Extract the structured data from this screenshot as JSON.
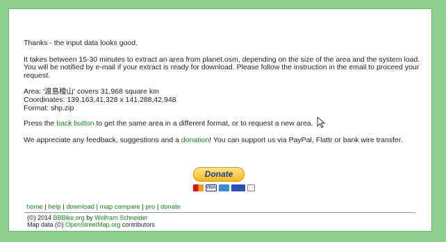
{
  "message": {
    "thanks": "Thanks - the input data looks good.",
    "info": "It takes between 15-30 minutes to extract an area from planet.osm, depending on the size of the area and the system load. You will be notified by e-mail if your extract is ready for download. Please follow the instruction in the email to proceed your request.",
    "area_prefix": "Area: '",
    "area_name": "渡島檜山",
    "area_suffix": "' covers 31,968 square km",
    "coordinates": "Coordinates: 139.163,41.328 x 141.288,42.948",
    "format": "Format: shp.zip",
    "press_prefix": "Press the ",
    "back_button": "back button",
    "press_suffix": " to get the same area in a different format, or to request a new area.",
    "appreciate_prefix": "We appreciate any feedback, suggestions and a ",
    "donation_link": "donation",
    "appreciate_suffix": "! You can support us via PayPal, Flattr or bank wire transfer."
  },
  "donate": {
    "label": "Donate",
    "cards": [
      "mastercard",
      "VISA",
      "amex",
      "giropay",
      "bank"
    ]
  },
  "footer": {
    "nav": [
      "home",
      "help",
      "download",
      "map compare",
      "pro",
      "donate"
    ],
    "separator": " | ",
    "copyright_prefix": "(©) 2014 ",
    "bbbike_link": "BBBike.org",
    "by_text": " by ",
    "author_link": "Wolfram Schneider",
    "mapdata_prefix": "Map data (©) ",
    "osm_link": "OpenStreetMap.org",
    "mapdata_suffix": " contributors"
  },
  "colors": {
    "background": "#8fcf8f",
    "link": "#1a8a1a",
    "donate_button": "#f6b622"
  }
}
